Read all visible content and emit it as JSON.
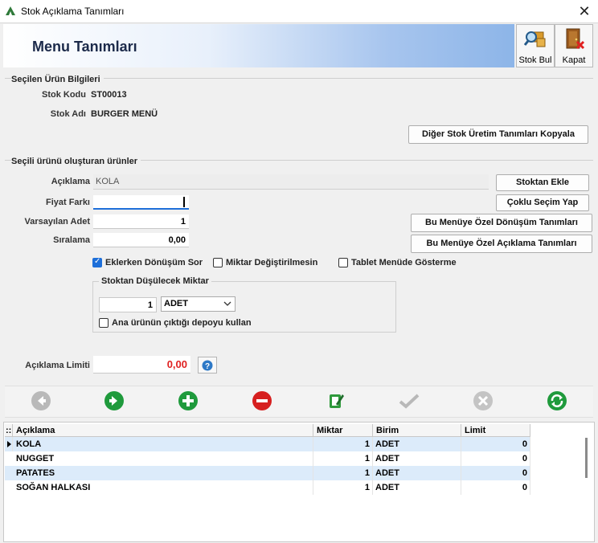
{
  "window": {
    "title": "Stok Açıklama Tanımları",
    "close_label": "✕"
  },
  "header": {
    "title": "Menu Tanımları"
  },
  "toolbar": {
    "stok_bul": "Stok Bul",
    "kapat": "Kapat"
  },
  "product_info": {
    "section_title": "Seçilen Ürün Bilgileri",
    "stok_kodu_label": "Stok Kodu",
    "stok_kodu_value": "ST00013",
    "stok_adi_label": "Stok Adı",
    "stok_adi_value": "BURGER MENÜ",
    "copy_button": "Diğer Stok Üretim Tanımları Kopyala"
  },
  "components": {
    "section_title": "Seçili ürünü oluşturan ürünler",
    "aciklama_label": "Açıklama",
    "aciklama_value": "KOLA",
    "fiyat_farki_label": "Fiyat Farkı",
    "fiyat_farki_value": "",
    "varsayilan_adet_label": "Varsayılan Adet",
    "varsayilan_adet_value": "1",
    "siralama_label": "Sıralama",
    "siralama_value": "0,00",
    "stoktan_ekle": "Stoktan Ekle",
    "coklu_secim": "Çoklu Seçim Yap",
    "donusum_tanimlari": "Bu Menüye Özel Dönüşüm Tanımları",
    "aciklama_tanimlari": "Bu Menüye Özel Açıklama Tanımları",
    "checkboxes": {
      "eklerken_donusum": {
        "label": "Eklerken Dönüşüm Sor",
        "checked": true
      },
      "miktar_degistirilmesin": {
        "label": "Miktar Değiştirilmesin",
        "checked": false
      },
      "tablet_menude": {
        "label": "Tablet Menüde Gösterme",
        "checked": false
      }
    },
    "stock_deduction": {
      "group_title": "Stoktan Düşülecek Miktar",
      "quantity": "1",
      "unit": "ADET",
      "ana_urun_label": "Ana ürünün çıktığı depoyu kullan",
      "ana_urun_checked": false
    },
    "aciklama_limiti_label": "Açıklama Limiti",
    "aciklama_limiti_value": "0,00",
    "help_icon": "question-icon"
  },
  "nav_icons": [
    "back-arrow-icon",
    "forward-arrow-icon",
    "add-icon",
    "delete-icon",
    "edit-icon",
    "confirm-check-icon",
    "cancel-x-icon",
    "refresh-icon"
  ],
  "grid": {
    "columns": [
      "Açıklama",
      "Miktar",
      "Birim",
      "Limit"
    ],
    "rows": [
      {
        "aciklama": "KOLA",
        "miktar": "1",
        "birim": "ADET",
        "limit": "0"
      },
      {
        "aciklama": "NUGGET",
        "miktar": "1",
        "birim": "ADET",
        "limit": "0"
      },
      {
        "aciklama": "PATATES",
        "miktar": "1",
        "birim": "ADET",
        "limit": "0"
      },
      {
        "aciklama": "SOĞAN HALKASI",
        "miktar": "1",
        "birim": "ADET",
        "limit": "0"
      }
    ]
  },
  "colors": {
    "accent": "#1e6fd9",
    "limit_value": "#e02020",
    "row_highlight": "#dcebfa"
  }
}
